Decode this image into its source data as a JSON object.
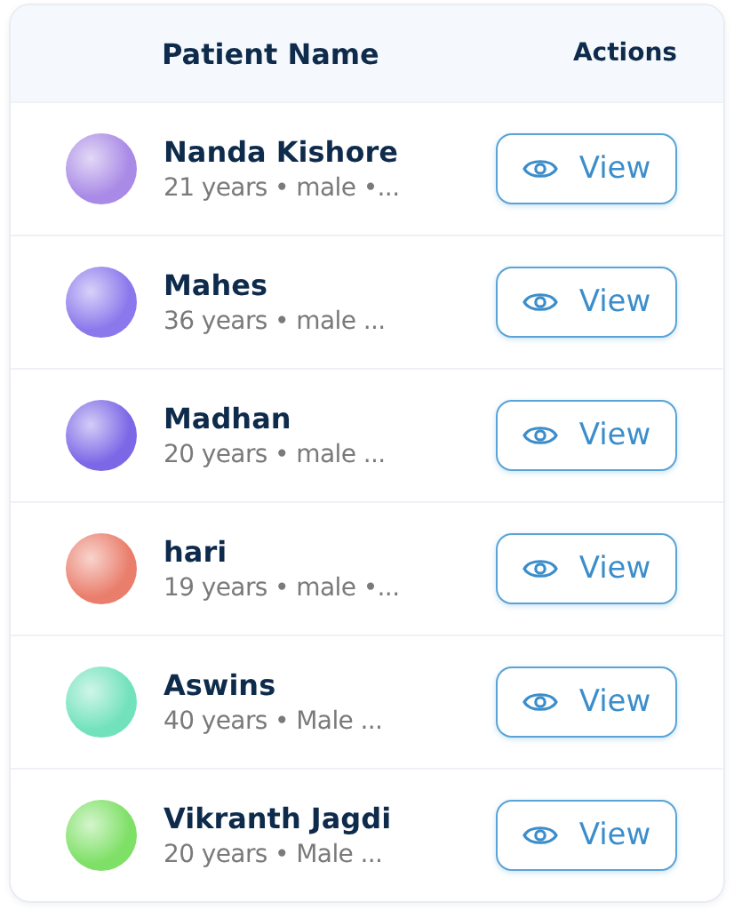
{
  "table": {
    "columns": [
      "Patient Name",
      "Actions"
    ],
    "rows": [
      {
        "name": "Nanda Kishore",
        "details": "21 years • male •...",
        "color": "#a98ae6",
        "action": "View"
      },
      {
        "name": "Mahes",
        "details": "36 years • male ...",
        "color": "#8a78ec",
        "action": "View"
      },
      {
        "name": "Madhan",
        "details": "20 years • male ...",
        "color": "#7c68e6",
        "action": "View"
      },
      {
        "name": "hari",
        "details": "19 years • male •...",
        "color": "#ea7e6c",
        "action": "View"
      },
      {
        "name": "Aswins",
        "details": "40 years • Male ...",
        "color": "#72e2bc",
        "action": "View"
      },
      {
        "name": "Vikranth Jagdi",
        "details": "20 years • Male ...",
        "color": "#7ee066",
        "action": "View"
      }
    ]
  }
}
